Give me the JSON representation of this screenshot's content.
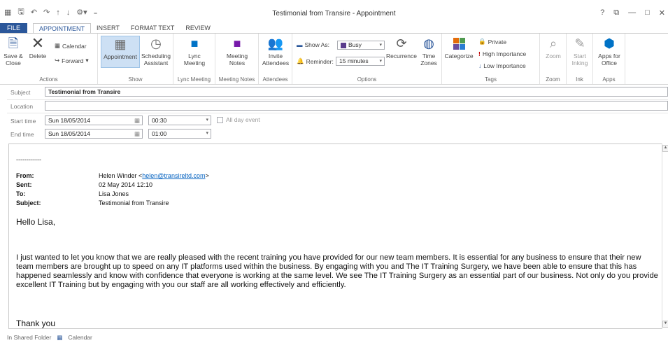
{
  "window": {
    "title": "Testimonial from Transire - Appointment",
    "controls": [
      "?",
      "⧉",
      "—",
      "□",
      "✕"
    ]
  },
  "tabs": [
    {
      "label": "FILE"
    },
    {
      "label": "APPOINTMENT"
    },
    {
      "label": "INSERT"
    },
    {
      "label": "FORMAT TEXT"
    },
    {
      "label": "REVIEW"
    }
  ],
  "ribbon": {
    "actions": {
      "save_close": "Save & Close",
      "delete": "Delete",
      "calendar": "Calendar",
      "forward": "Forward",
      "group": "Actions"
    },
    "show": {
      "appointment": "Appointment",
      "scheduling": "Scheduling Assistant",
      "group": "Show"
    },
    "lync": {
      "meeting": "Lync Meeting",
      "group": "Lync Meeting"
    },
    "notes": {
      "meeting_notes": "Meeting Notes",
      "group": "Meeting Notes"
    },
    "attendees": {
      "invite": "Invite Attendees",
      "group": "Attendees"
    },
    "options": {
      "show_as_label": "Show As:",
      "show_as_value": "Busy",
      "reminder_label": "Reminder:",
      "reminder_value": "15 minutes",
      "recurrence": "Recurrence",
      "time_zones": "Time Zones",
      "group": "Options"
    },
    "tags": {
      "categorize": "Categorize",
      "private": "Private",
      "high": "High Importance",
      "low": "Low Importance",
      "group": "Tags"
    },
    "zoom": {
      "zoom": "Zoom",
      "group": "Zoom"
    },
    "ink": {
      "start_inking": "Start Inking",
      "group": "Ink"
    },
    "apps": {
      "apps_for_office": "Apps for Office",
      "group": "Apps"
    }
  },
  "form": {
    "subject_label": "Subject",
    "subject_value": "Testimonial from Transire",
    "location_label": "Location",
    "location_value": "",
    "start_label": "Start time",
    "start_date": "Sun 18/05/2014",
    "start_time": "00:30",
    "all_day": "All day event",
    "end_label": "End time",
    "end_date": "Sun 18/05/2014",
    "end_time": "01:00"
  },
  "message": {
    "dashes": "------------",
    "from_label": "From:",
    "from_name": "Helen Winder <",
    "from_email": "helen@transireltd.com",
    "from_close": ">",
    "sent_label": "Sent:",
    "sent_value": "02 May 2014 12:10",
    "to_label": "To:",
    "to_value": "Lisa Jones",
    "subject_label": "Subject:",
    "subject_value": "Testimonial from Transire",
    "greeting": "Hello Lisa,",
    "paragraph": "I just wanted to let you know that we are really pleased with the recent training you have provided for our new team members.  It is essential for any business to ensure that their new team members are brought up to speed on any IT platforms used within the business.  By engaging with you and The IT Training Surgery, we have been able to ensure that this has happened seamlessly and know with confidence that everyone is working at the same level.  We see The IT Training Surgery as an essential part of our business.  Not only do you provide excellent IT Training but by engaging with you our staff are all working effectively and efficiently.",
    "thanks": "Thank you"
  },
  "status": {
    "folder_text": "In Shared Folder",
    "calendar": "Calendar"
  }
}
